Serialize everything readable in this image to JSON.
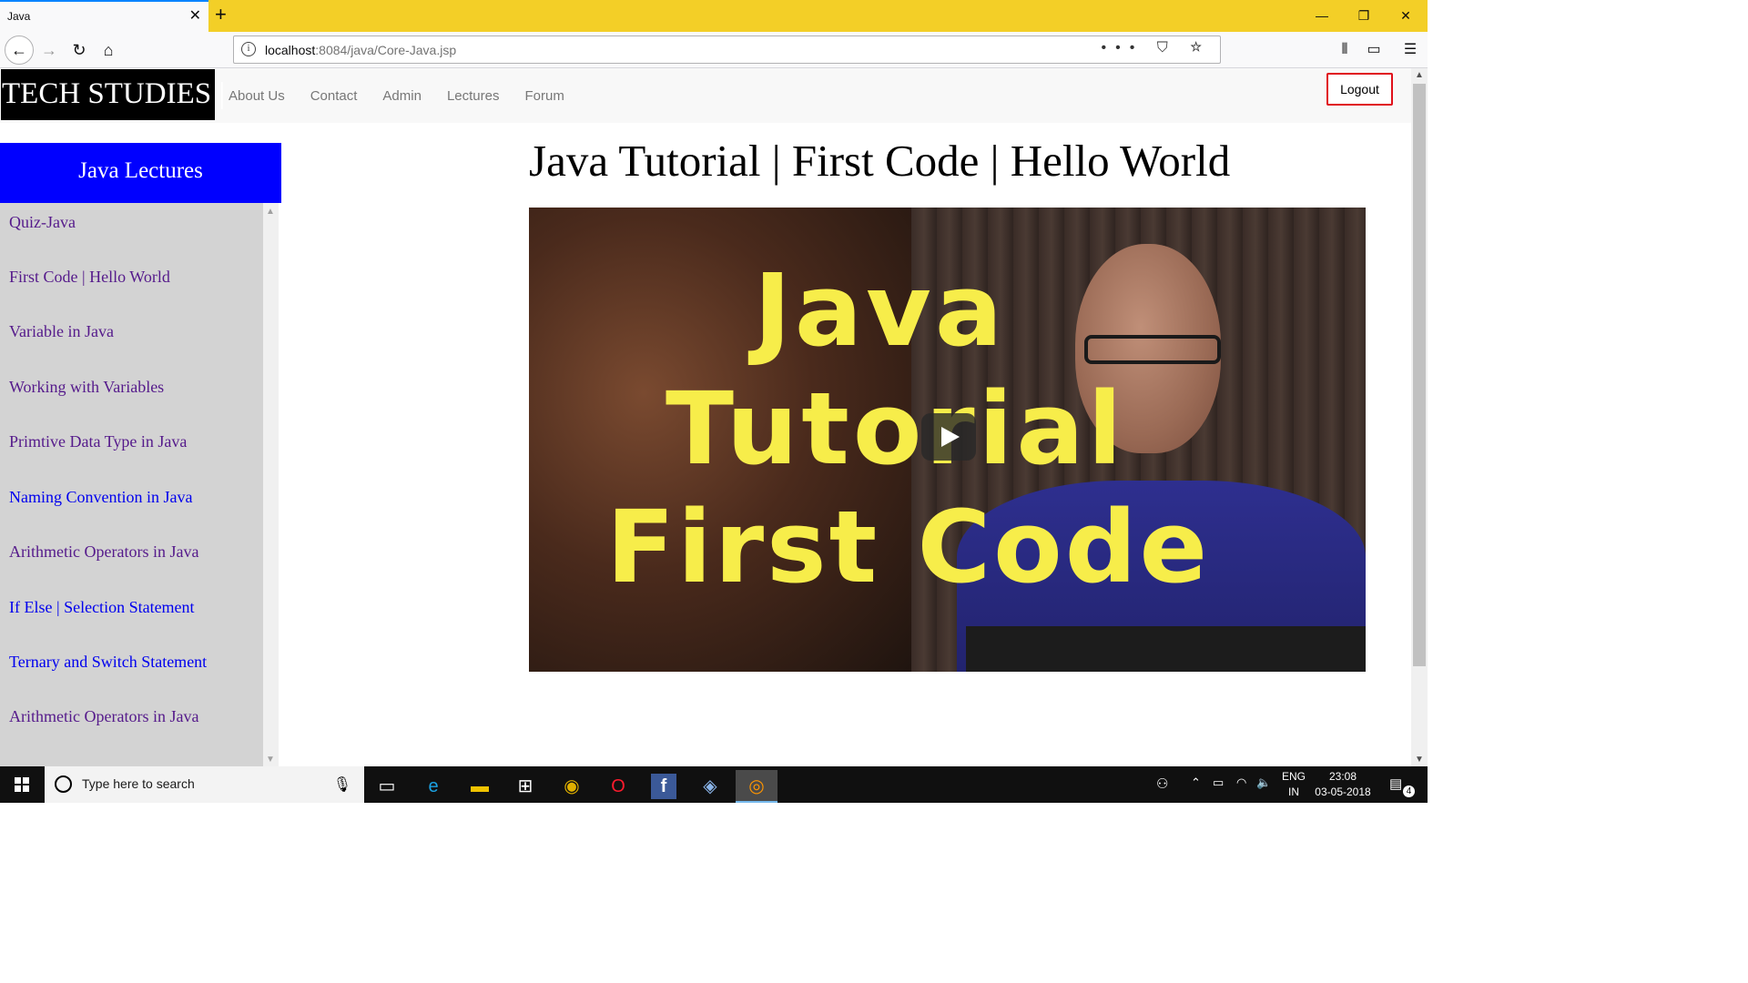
{
  "browser": {
    "tab_title": "Java",
    "tab_close": "✕",
    "new_tab": "+",
    "url_host": "localhost",
    "url_rest": ":8084/java/Core-Java.jsp",
    "url_actions": "••• ⛉ ☆",
    "window_controls": [
      "—",
      "❐",
      "✕"
    ]
  },
  "site": {
    "logo": "TECH STUDIES |",
    "nav": [
      "About Us",
      "Contact",
      "Admin",
      "Lectures",
      "Forum"
    ],
    "logout_label": "Logout"
  },
  "sidebar": {
    "heading": "Java Lectures",
    "lectures": [
      {
        "label": "Quiz-Java",
        "visited": true
      },
      {
        "label": "First Code | Hello World",
        "visited": true
      },
      {
        "label": "Variable in Java",
        "visited": true
      },
      {
        "label": "Working with Variables",
        "visited": true
      },
      {
        "label": "Primtive Data Type in Java",
        "visited": true
      },
      {
        "label": "Naming Convention in Java",
        "visited": false
      },
      {
        "label": "Arithmetic Operators in Java",
        "visited": true
      },
      {
        "label": "If Else | Selection Statement",
        "visited": false
      },
      {
        "label": "Ternary and Switch Statement",
        "visited": false
      },
      {
        "label": "Arithmetic Operators in Java",
        "visited": true
      }
    ]
  },
  "main": {
    "title": "Java Tutorial | First Code | Hello World",
    "video_text": [
      "Java",
      "Tutorial",
      "First Code"
    ]
  },
  "taskbar": {
    "search_placeholder": "Type here to search",
    "lang_top": "ENG",
    "lang_bottom": "IN",
    "time": "23:08",
    "date": "03-05-2018",
    "notification_count": "4"
  },
  "colors": {
    "tab_strip": "#f3cf27",
    "sidebar_head": "#0000ff",
    "logout_border": "#e0101a",
    "video_text": "#f7ed4a"
  }
}
